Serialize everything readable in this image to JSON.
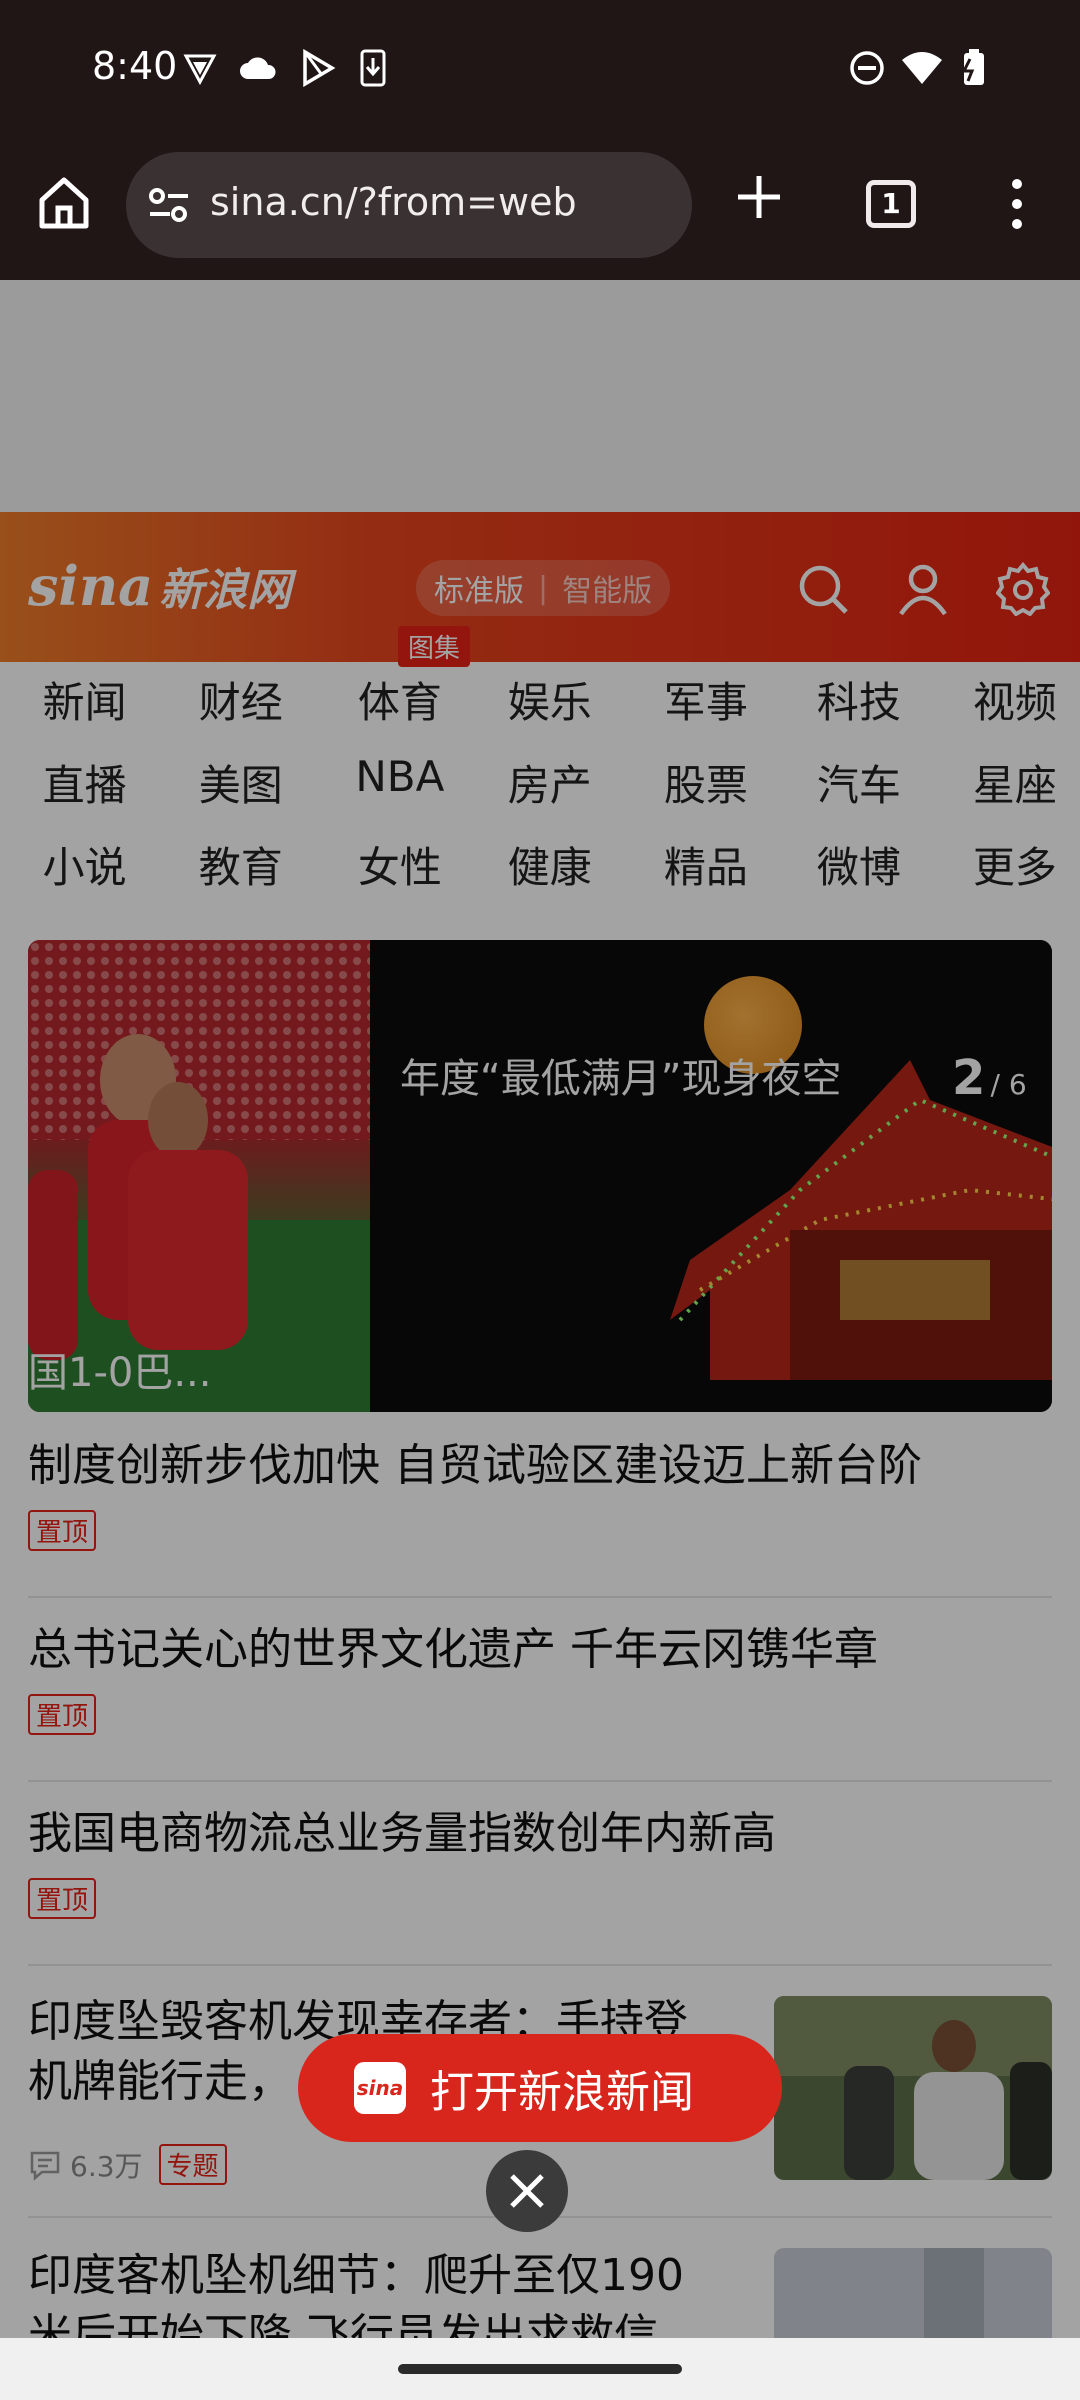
{
  "status_bar": {
    "time": "8:40",
    "icons_left": [
      "vpn-shield-icon",
      "cloud-icon",
      "play-store-icon",
      "download-icon"
    ],
    "icons_right": [
      "do-not-disturb-icon",
      "wifi-icon",
      "battery-charging-icon"
    ]
  },
  "browser": {
    "url": "sina.cn/?from=web",
    "tab_count": "1"
  },
  "header": {
    "logo_en": "sina",
    "logo_cn": "新浪网",
    "version_standard": "标准版",
    "version_smart": "智能版",
    "colors": {
      "gradient_start": "#ef7d2a",
      "gradient_end": "#e32212"
    }
  },
  "nav_channels": [
    "新闻",
    "财经",
    "体育",
    "娱乐",
    "军事",
    "科技",
    "视频",
    "直播",
    "美图",
    "NBA",
    "房产",
    "股票",
    "汽车",
    "星座",
    "小说",
    "教育",
    "女性",
    "健康",
    "精品",
    "微博",
    "更多"
  ],
  "carousel": {
    "left_caption": "国1-0巴...",
    "tag": "图集",
    "caption": "年度“最低满月”现身夜空",
    "current": "2",
    "total": "/ 6"
  },
  "news": [
    {
      "title": "制度创新步伐加快 自贸试验区建设迈上新台阶",
      "badge": "置顶"
    },
    {
      "title": "总书记关心的世界文化遗产 千年云冈镌华章",
      "badge": "置顶"
    },
    {
      "title": "我国电商物流总业务量指数创年内新高",
      "badge": "置顶"
    },
    {
      "title_line1": "印度坠毁客机发现幸存者：手持登",
      "title_line2": "机牌能行走，",
      "comments": "6.3万",
      "badge": "专题"
    },
    {
      "title_line1": "印度客机坠机细节：爬升至仅190",
      "title_line2": "米后开始下降 飞行员发出求救信"
    }
  ],
  "open_app": {
    "label": "打开新浪新闻",
    "icon_text": "sina"
  },
  "accent_color": "#e62117"
}
